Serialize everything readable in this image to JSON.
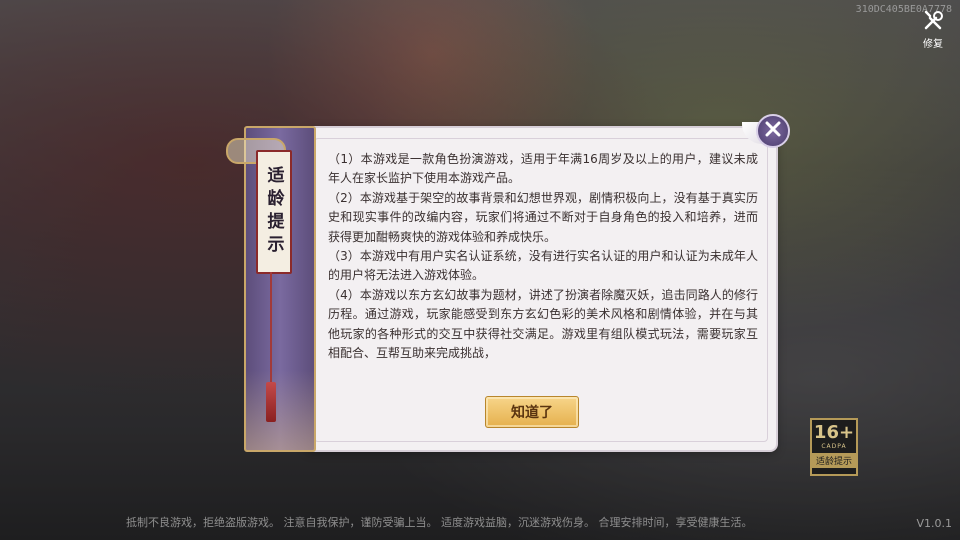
{
  "device_id": "310DC405BE0A7778",
  "repair": {
    "label": "修复",
    "icon": "repair-tools-icon"
  },
  "dialog": {
    "title": "适龄提示",
    "paragraphs": [
      "（1）本游戏是一款角色扮演游戏，适用于年满16周岁及以上的用户，建议未成年人在家长监护下使用本游戏产品。",
      "（2）本游戏基于架空的故事背景和幻想世界观，剧情积极向上，没有基于真实历史和现实事件的改编内容，玩家们将通过不断对于自身角色的投入和培养，进而获得更加酣畅爽快的游戏体验和养成快乐。",
      "（3）本游戏中有用户实名认证系统，没有进行实名认证的用户和认证为未成年人的用户将无法进入游戏体验。",
      "（4）本游戏以东方玄幻故事为题材，讲述了扮演者除魔灭妖，追击同路人的修行历程。通过游戏，玩家能感受到东方玄幻色彩的美术风格和剧情体验，并在与其他玩家的各种形式的交互中获得社交满足。游戏里有组队模式玩法，需要玩家互相配合、互帮互助来完成挑战，"
    ],
    "ok_label": "知道了",
    "close_icon": "close-icon"
  },
  "age_badge": {
    "age": "16+",
    "org": "CADPA",
    "tip": "适龄提示"
  },
  "footer": "抵制不良游戏，拒绝盗版游戏。 注意自我保护，谨防受骗上当。 适度游戏益脑，沉迷游戏伤身。 合理安排时间，享受健康生活。",
  "version": "V1.0.1",
  "colors": {
    "accent_purple": "#6a5a8c",
    "gold": "#e5b04c",
    "paper": "#f3f0f2"
  }
}
